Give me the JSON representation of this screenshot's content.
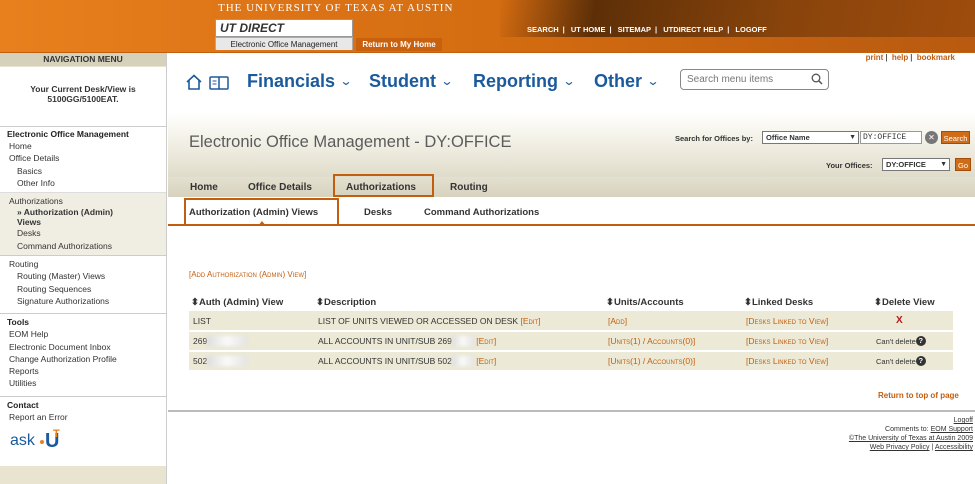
{
  "banner": {
    "university": "THE UNIVERSITY OF TEXAS AT AUSTIN",
    "logo_text": "UT DIRECT",
    "tab_eom": "Electronic Office Management",
    "tab_home": "Return to My Home",
    "links": [
      "SEARCH",
      "UT HOME",
      "SITEMAP",
      "UTDIRECT HELP",
      "LOGOFF"
    ]
  },
  "nav": {
    "title": "NAVIGATION MENU",
    "desk_line1": "Your Current Desk/View is",
    "desk_line2": "5100GG/5100EAT.",
    "sections": [
      {
        "head": "Electronic Office Management",
        "items": [
          "Home",
          "Office Details"
        ],
        "subs": [
          "Basics",
          "Other Info"
        ]
      },
      {
        "head": "Authorizations",
        "subs": [
          "» Authorization (Admin)",
          "Views",
          "Desks",
          "Command Authorizations"
        ]
      },
      {
        "head": "Routing",
        "subs": [
          "Routing (Master) Views",
          "Routing Sequences",
          "Signature Authorizations"
        ]
      },
      {
        "head": "Tools",
        "items": [
          "EOM Help",
          "Electronic Document Inbox",
          "Change Authorization Profile",
          "Reports",
          "Utilities"
        ]
      },
      {
        "head": "Contact",
        "items": [
          "Report an Error"
        ]
      }
    ],
    "ask_logo": "ask.UT"
  },
  "utility_links": {
    "print": "print",
    "help": "help",
    "bookmark": "bookmark"
  },
  "mega_menu": {
    "items": [
      "Financials",
      "Student",
      "Reporting",
      "Other"
    ],
    "search_placeholder": "Search menu items"
  },
  "page": {
    "title": "Electronic Office Management - DY:OFFICE",
    "search_label": "Search for Offices by:",
    "search_by": "Office Name",
    "search_value": "DY:OFFICE",
    "search_button": "Search",
    "your_offices_label": "Your Offices:",
    "your_office": "DY:OFFICE",
    "go_button": "Go"
  },
  "tabs": {
    "main": [
      "Home",
      "Office Details",
      "Authorizations",
      "Routing"
    ],
    "sub": [
      "Authorization (Admin) Views",
      "Desks",
      "Command Authorizations"
    ]
  },
  "table": {
    "add_link": "[Add Authorization (Admin) View]",
    "headers": [
      "Auth (Admin) View",
      "Description",
      "Units/Accounts",
      "Linked Desks",
      "Delete View"
    ],
    "rows": [
      {
        "view": "LIST",
        "desc": "LIST OF UNITS VIEWED OR ACCESSED ON DESK",
        "edit": "[Edit]",
        "units": "[Add]",
        "desks": "[Desks Linked to View]",
        "delete": "X"
      },
      {
        "view": "269",
        "desc": "ALL ACCOUNTS IN UNIT/SUB 269",
        "edit": "[Edit]",
        "units": "[Units(1) / Accounts(0)]",
        "desks": "[Desks Linked to View]",
        "delete": "Can't delete"
      },
      {
        "view": "502",
        "desc": "ALL ACCOUNTS IN UNIT/SUB 502",
        "edit": "[Edit]",
        "units": "[Units(1) / Accounts(0)]",
        "desks": "[Desks Linked to View]",
        "delete": "Can't delete"
      }
    ]
  },
  "footer": {
    "return_top": "Return to top of page",
    "logoff": "Logoff",
    "comments": "Comments to:",
    "support": "EOM Support",
    "copyright": "©The University of Texas at Austin 2009",
    "privacy": "Web Privacy Policy",
    "accessibility": "Accessibility"
  },
  "colors": {
    "brand_orange": "#c25e10",
    "link_blue": "#1b5a9c",
    "nav_bg": "#e8e4cf"
  }
}
